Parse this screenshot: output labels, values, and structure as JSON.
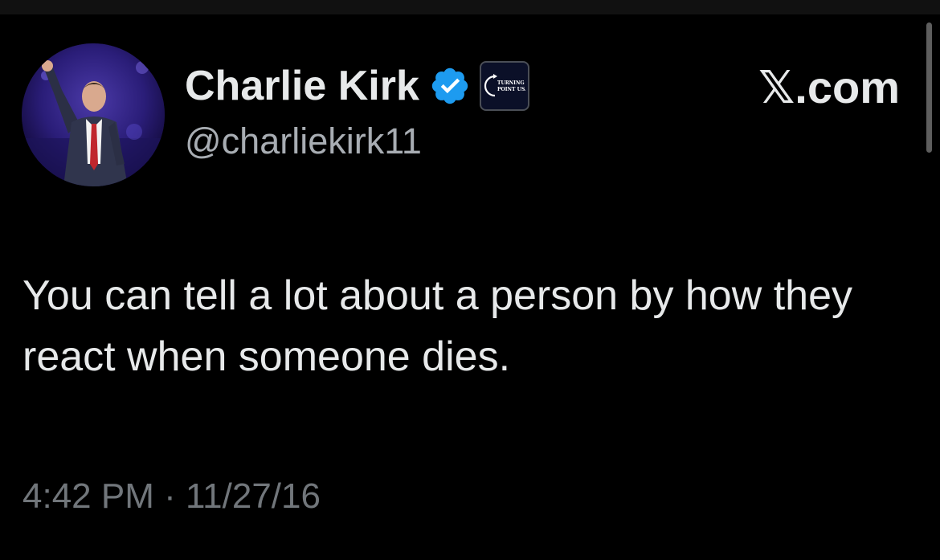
{
  "author": {
    "display_name": "Charlie Kirk",
    "handle": "@charliekirk11",
    "verified_icon": "verified-badge-icon",
    "affiliate_logo": "turning-point-usa-logo",
    "affiliate_logo_text": "TURNING POINT USA"
  },
  "source": {
    "label": "𝕏.com"
  },
  "tweet": {
    "text": "You can tell a lot about a person by how they react when someone dies.",
    "timestamp": "4:42 PM · 11/27/16"
  },
  "colors": {
    "background": "#000000",
    "primary_text": "#e7e9ea",
    "secondary_text": "#71767b",
    "handle_text": "#a8adb3",
    "verified_blue": "#1d9bf0"
  }
}
